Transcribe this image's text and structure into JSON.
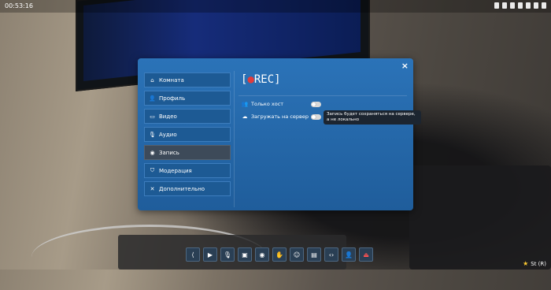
{
  "status_bar": {
    "time": "00:53:16",
    "icons": [
      "location-icon",
      "signal-icon",
      "wifi-icon",
      "bluetooth-icon",
      "battery-icon",
      "settings-icon",
      "mic-icon"
    ]
  },
  "dialog": {
    "close_symbol": "×",
    "menu": [
      {
        "icon": "home-icon",
        "glyph": "⌂",
        "label": "Комната"
      },
      {
        "icon": "profile-icon",
        "glyph": "👤",
        "label": "Профиль"
      },
      {
        "icon": "video-icon",
        "glyph": "▭",
        "label": "Видео"
      },
      {
        "icon": "audio-icon",
        "glyph": "🎙",
        "label": "Аудио"
      },
      {
        "icon": "record-icon",
        "glyph": "◉",
        "label": "Запись"
      },
      {
        "icon": "shield-icon",
        "glyph": "⛉",
        "label": "Модерация"
      },
      {
        "icon": "tools-icon",
        "glyph": "✕",
        "label": "Дополнительно"
      }
    ],
    "active_index": 4,
    "rec_title": {
      "open": "[",
      "dot": "●",
      "text": "REC",
      "close": "]"
    },
    "options": [
      {
        "icon": "users-icon",
        "glyph": "👥",
        "label": "Только хост"
      },
      {
        "icon": "cloud-upload-icon",
        "glyph": "☁",
        "label": "Загружать на сервер"
      }
    ],
    "tooltip": "Запись будет сохраняться на сервере, а не локально"
  },
  "toolbar": [
    {
      "name": "share-button",
      "icon": "share-icon",
      "glyph": "⟨"
    },
    {
      "name": "camera-button",
      "icon": "camera-icon",
      "glyph": "▶"
    },
    {
      "name": "mic-button",
      "icon": "mic-icon",
      "glyph": "🎙"
    },
    {
      "name": "screen-share-button",
      "icon": "screen-share-icon",
      "glyph": "▣"
    },
    {
      "name": "record-button",
      "icon": "record-icon",
      "glyph": "◉"
    },
    {
      "name": "raise-hand-button",
      "icon": "hand-icon",
      "glyph": "✋"
    },
    {
      "name": "emoji-button",
      "icon": "emoji-icon",
      "glyph": "☺"
    },
    {
      "name": "chat-button",
      "icon": "chat-icon",
      "glyph": "▤"
    },
    {
      "name": "code-button",
      "icon": "code-icon",
      "glyph": "‹›"
    },
    {
      "name": "participants-button",
      "icon": "user-settings-icon",
      "glyph": "👤"
    },
    {
      "name": "leave-button",
      "icon": "exit-icon",
      "glyph": "⏏"
    }
  ],
  "corner": {
    "star": "★",
    "label": "St (R)"
  },
  "colors": {
    "dialog": "#2b73b8",
    "active_menu": "#3d4a59",
    "rec_dot": "#e23b3b",
    "leave": "#ff5252"
  }
}
